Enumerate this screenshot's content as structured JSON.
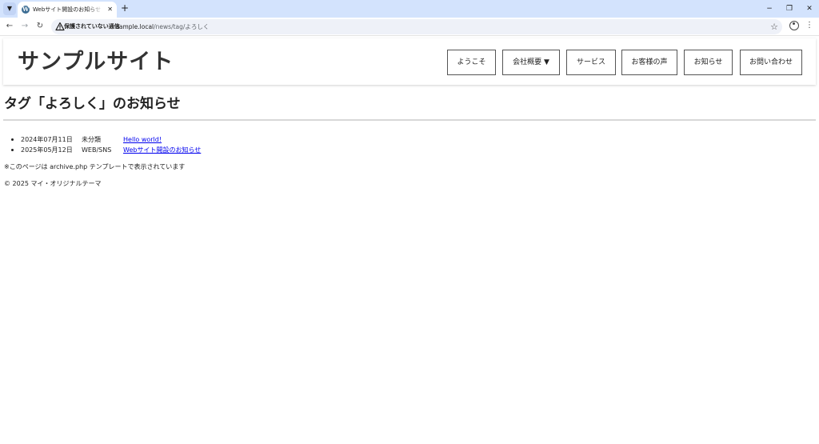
{
  "browser": {
    "tab_title": "Webサイト開設のお知らせ｜サンプルサイト",
    "security_label": "保護されていない通信",
    "url_host": "sample.local",
    "url_path": "/news/tag/よろしく",
    "icons": {
      "tab_list": "chevron-down-icon",
      "favicon": "wordpress-icon",
      "tab_close": "close-icon",
      "new_tab": "plus-icon",
      "minimize": "minimize-icon",
      "restore": "restore-icon",
      "close_window": "close-icon",
      "back": "back-arrow-icon",
      "forward": "forward-arrow-icon",
      "reload": "reload-icon",
      "security": "warning-triangle-icon",
      "bookmark": "star-icon",
      "profile": "profile-icon",
      "menu": "more-vertical-icon"
    },
    "colors": {
      "tabstrip": "#d3e3fd",
      "omnibox": "#eef1f8"
    }
  },
  "header": {
    "site_title": "サンプルサイト",
    "nav": [
      {
        "label": "ようこそ"
      },
      {
        "label": "会社概要 ▼"
      },
      {
        "label": "サービス"
      },
      {
        "label": "お客様の声"
      },
      {
        "label": "お知らせ"
      },
      {
        "label": "お問い合わせ"
      }
    ]
  },
  "main": {
    "heading": "タグ「よろしく」のお知らせ",
    "posts": [
      {
        "date": "2024年07月11日",
        "category": "未分類",
        "title": "Hello world!"
      },
      {
        "date": "2025年05月12日",
        "category": "WEB/SNS",
        "title": "Webサイト開設のお知らせ"
      }
    ],
    "template_note": "※このページは archive.php テンプレートで表示されています"
  },
  "footer": {
    "copyright": "© 2025 マイ・オリジナルテーマ"
  },
  "colors": {
    "link": "#0000ee",
    "text": "#222222",
    "site_title": "#333333"
  }
}
